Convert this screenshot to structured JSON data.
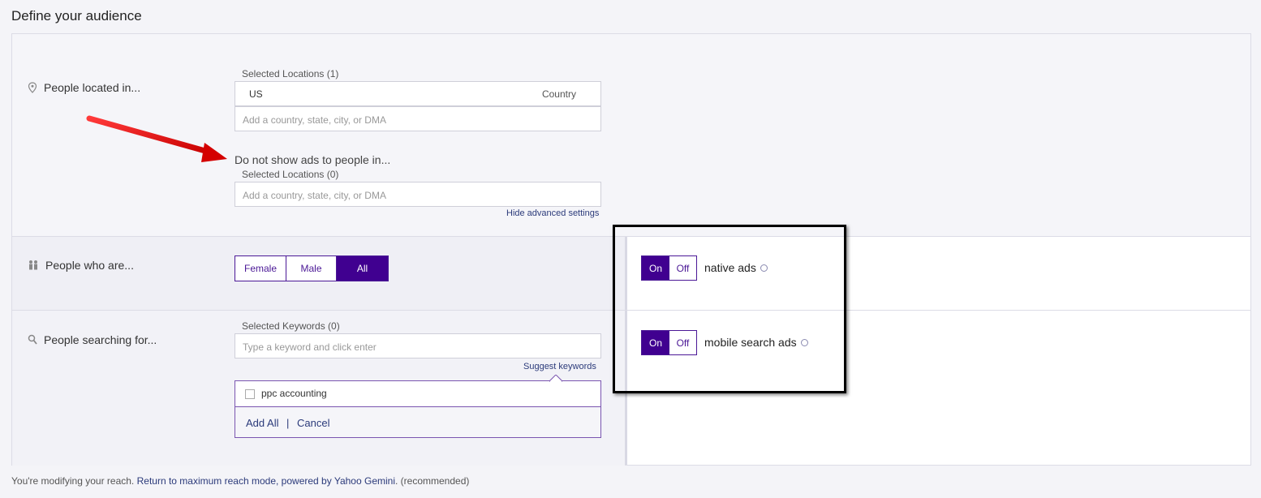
{
  "page": {
    "title": "Define your audience"
  },
  "location_section": {
    "label": "People located in...",
    "selected_label": "Selected Locations (1)",
    "selected_item": {
      "name": "US",
      "type": "Country"
    },
    "input_placeholder": "Add a country, state, city, or DMA",
    "exclude_heading": "Do not show ads to people in...",
    "exclude_selected_label": "Selected Locations (0)",
    "exclude_input_placeholder": "Add a country, state, city, or DMA",
    "hide_advanced_link": "Hide advanced settings"
  },
  "gender_section": {
    "label": "People who are...",
    "options": [
      "Female",
      "Male",
      "All"
    ],
    "selected": "All"
  },
  "keyword_section": {
    "label": "People searching for...",
    "selected_label": "Selected Keywords (0)",
    "input_placeholder": "Type a keyword and click enter",
    "suggest_link": "Suggest keywords",
    "suggestions": [
      {
        "text": "ppc accounting",
        "checked": false
      }
    ],
    "add_all": "Add All",
    "separator": "|",
    "cancel": "Cancel"
  },
  "toggles": [
    {
      "on_label": "On",
      "off_label": "Off",
      "state": "On",
      "label": "native ads"
    },
    {
      "on_label": "On",
      "off_label": "Off",
      "state": "On",
      "label": "mobile search ads"
    }
  ],
  "footer": {
    "prefix": "You're modifying your reach.",
    "link": "Return to maximum reach mode, powered by",
    "brand": "Yahoo Gemini",
    "suffix": ". (recommended)"
  },
  "colors": {
    "accent": "#400090",
    "link": "#2b3a7a",
    "annotation_arrow": "#e01010"
  }
}
